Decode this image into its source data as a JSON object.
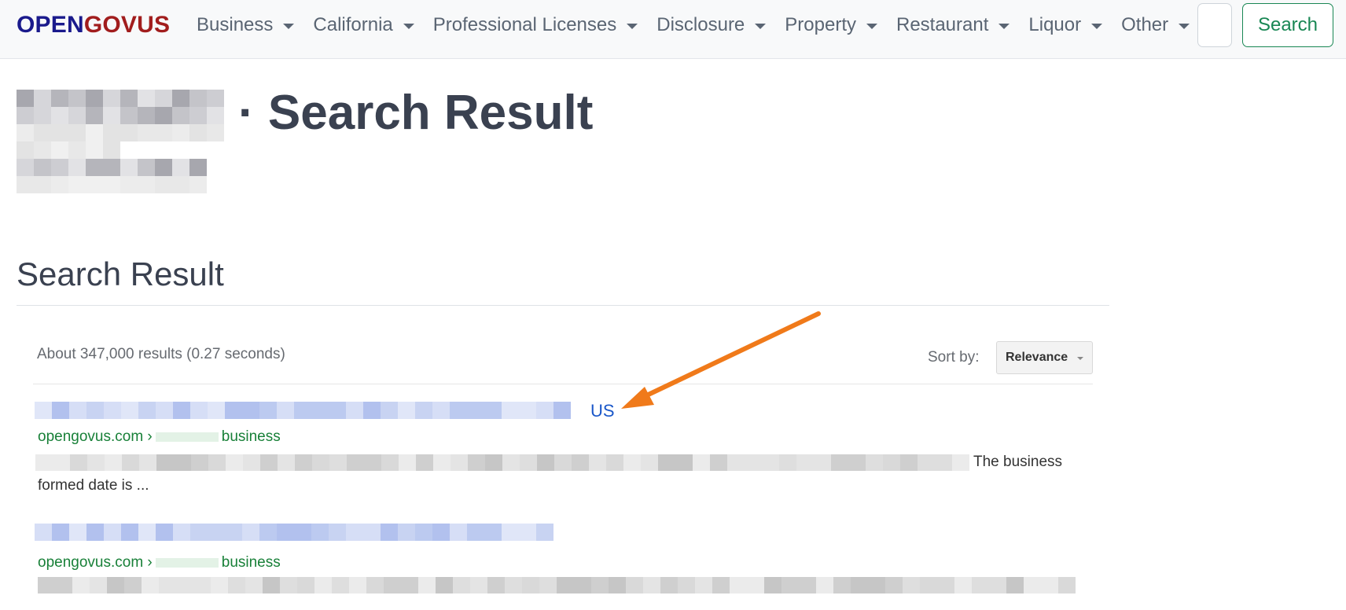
{
  "brand": {
    "part1": "OPEN",
    "part2": "GOVUS"
  },
  "nav": {
    "items": [
      {
        "label": "Business"
      },
      {
        "label": "California"
      },
      {
        "label": "Professional Licenses"
      },
      {
        "label": "Disclosure"
      },
      {
        "label": "Property"
      },
      {
        "label": "Restaurant"
      },
      {
        "label": "Liquor"
      },
      {
        "label": "Other"
      }
    ],
    "search_value": "",
    "search_button": "Search"
  },
  "header": {
    "title": "· Search Result"
  },
  "section": {
    "heading": "Search Result"
  },
  "results_meta": {
    "stats": "About 347,000 results (0.27 seconds)",
    "sort_label": "Sort by:",
    "sort_value": "Relevance"
  },
  "results": [
    {
      "link_tail": "US",
      "url_prefix": "opengovus.com ›",
      "url_suffix": "business",
      "snippet_tail": "The business",
      "snippet_line2": "formed date is ..."
    },
    {
      "link_tail": "",
      "url_prefix": "opengovus.com ›",
      "url_suffix": "business"
    }
  ],
  "colors": {
    "brand_blue": "#1a1a8c",
    "brand_red": "#a11d1d",
    "link_blue": "#1a57c9",
    "url_green": "#188038",
    "search_green": "#198754",
    "arrow_orange": "#f07a1a"
  }
}
